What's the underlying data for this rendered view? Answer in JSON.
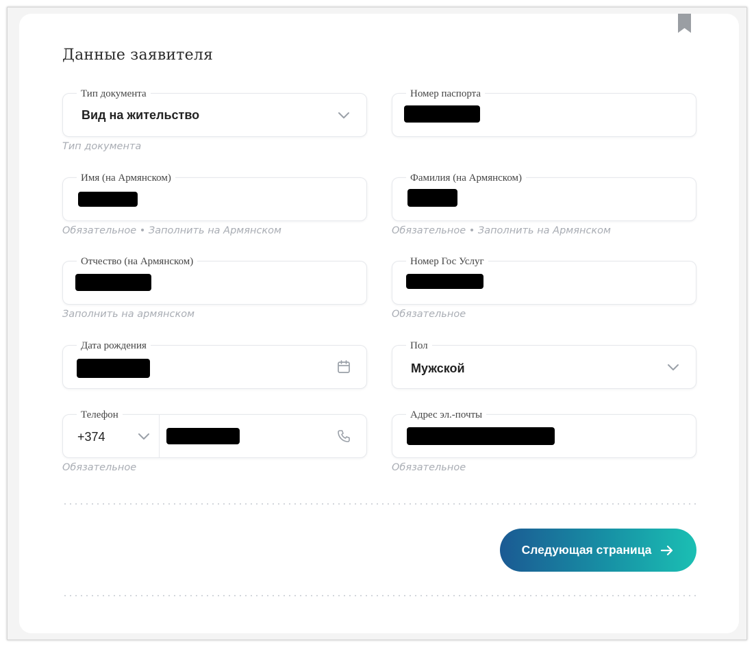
{
  "form": {
    "title": "Данные заявителя",
    "document_type": {
      "label": "Тип документа",
      "value": "Вид на жительство",
      "hint": "Тип документа"
    },
    "passport_number": {
      "label": "Номер паспорта",
      "hint": ""
    },
    "first_name": {
      "label": "Имя (на Армянском)",
      "hint": "Обязательное • Заполнить на Армянском"
    },
    "last_name": {
      "label": "Фамилия (на Армянском)",
      "hint": "Обязательное • Заполнить на Армянском"
    },
    "patronymic": {
      "label": "Отчество (на Армянском)",
      "hint": "Заполнить на армянском"
    },
    "gosuslugi_number": {
      "label": "Номер Гос Услуг",
      "hint": "Обязательное"
    },
    "birth_date": {
      "label": "Дата рождения",
      "hint": ""
    },
    "gender": {
      "label": "Пол",
      "value": "Мужской",
      "hint": ""
    },
    "phone": {
      "label": "Телефон",
      "country_code": "+374",
      "hint": "Обязательное"
    },
    "email": {
      "label": "Адрес эл.-почты",
      "hint": "Обязательное"
    },
    "next_button": {
      "label": "Следующая страница"
    }
  },
  "icons": {
    "bookmark": "bookmark-icon",
    "chevron": "chevron-down-icon",
    "calendar": "calendar-icon",
    "phone": "phone-icon",
    "arrow": "arrow-right-icon"
  },
  "colors": {
    "button_gradient_start": "#1b5a93",
    "button_gradient_end": "#1bbfb3",
    "hint": "#a9adb4",
    "redaction": "#000000"
  }
}
